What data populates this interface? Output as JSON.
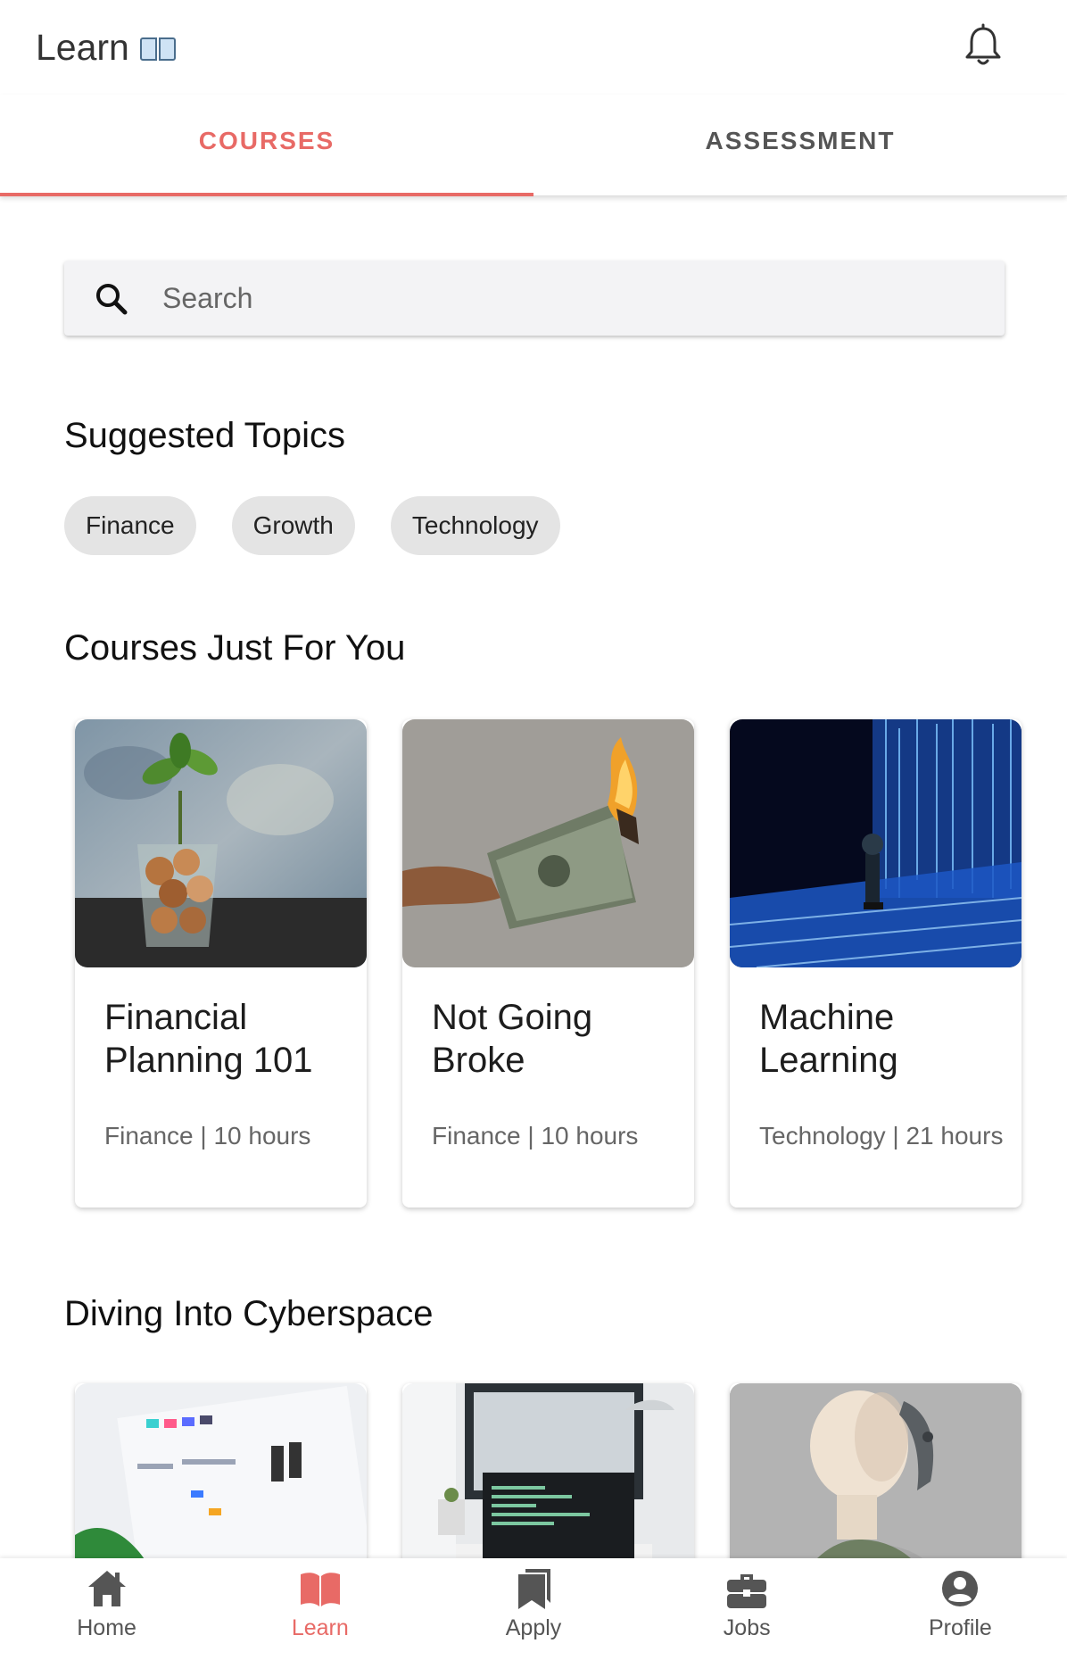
{
  "header": {
    "title": "Learn",
    "title_emoji": "open-book-icon",
    "notification_icon": "bell-icon"
  },
  "tabs": [
    {
      "label": "COURSES",
      "active": true
    },
    {
      "label": "ASSESSMENT",
      "active": false
    }
  ],
  "search": {
    "placeholder": "Search",
    "value": ""
  },
  "suggested_topics": {
    "heading": "Suggested Topics",
    "chips": [
      "Finance",
      "Growth",
      "Technology"
    ]
  },
  "courses_for_you": {
    "heading": "Courses Just For You",
    "cards": [
      {
        "title": "Financial Planning 101",
        "meta": "Finance | 10 hours",
        "image": "coins-with-plant-photo"
      },
      {
        "title": "Not Going Broke",
        "meta": "Finance | 10 hours",
        "image": "burning-money-photo"
      },
      {
        "title": "Machine Learning",
        "meta": "Technology | 21 hours",
        "image": "robot-digital-light-photo"
      }
    ]
  },
  "cyberspace": {
    "heading": "Diving Into Cyberspace",
    "cards": [
      {
        "image": "ui-design-screen-photo"
      },
      {
        "image": "laptop-code-desk-photo"
      },
      {
        "image": "humanoid-robot-photo"
      }
    ]
  },
  "bottom_nav": [
    {
      "label": "Home",
      "icon": "home-icon",
      "active": false
    },
    {
      "label": "Learn",
      "icon": "book-icon",
      "active": true
    },
    {
      "label": "Apply",
      "icon": "bookmarks-icon",
      "active": false
    },
    {
      "label": "Jobs",
      "icon": "briefcase-icon",
      "active": false
    },
    {
      "label": "Profile",
      "icon": "account-circle-icon",
      "active": false
    }
  ],
  "colors": {
    "accent": "#e86a66",
    "text": "#1c1c1c",
    "muted": "#666666",
    "chip_bg": "#e4e4e4"
  }
}
